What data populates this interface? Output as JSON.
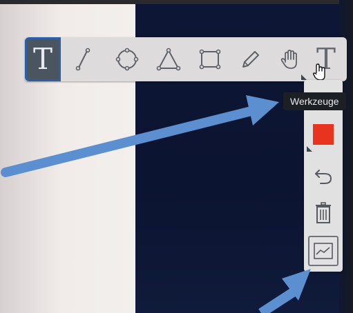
{
  "toolbar": {
    "tools": [
      {
        "name": "text",
        "icon": "text-icon",
        "glyph": "T",
        "active": true
      },
      {
        "name": "line",
        "icon": "line-icon"
      },
      {
        "name": "circle",
        "icon": "circle-icon"
      },
      {
        "name": "triangle",
        "icon": "triangle-icon"
      },
      {
        "name": "rectangle",
        "icon": "rectangle-icon"
      },
      {
        "name": "pencil",
        "icon": "pencil-icon"
      },
      {
        "name": "hand",
        "icon": "hand-icon"
      },
      {
        "name": "text-tool",
        "icon": "text-icon",
        "glyph": "T"
      }
    ]
  },
  "tooltip": {
    "text": "Werkzeuge"
  },
  "sidepanel": {
    "color_swatch": "#e8331f",
    "buttons": [
      "color-swatch",
      "undo-icon",
      "trash-icon",
      "chart-icon"
    ]
  },
  "colors": {
    "toolbar_bg": "#dddbdc",
    "active_bg": "#4a5560",
    "active_border": "#2c5ea8",
    "arrow": "#5b8fd0"
  }
}
